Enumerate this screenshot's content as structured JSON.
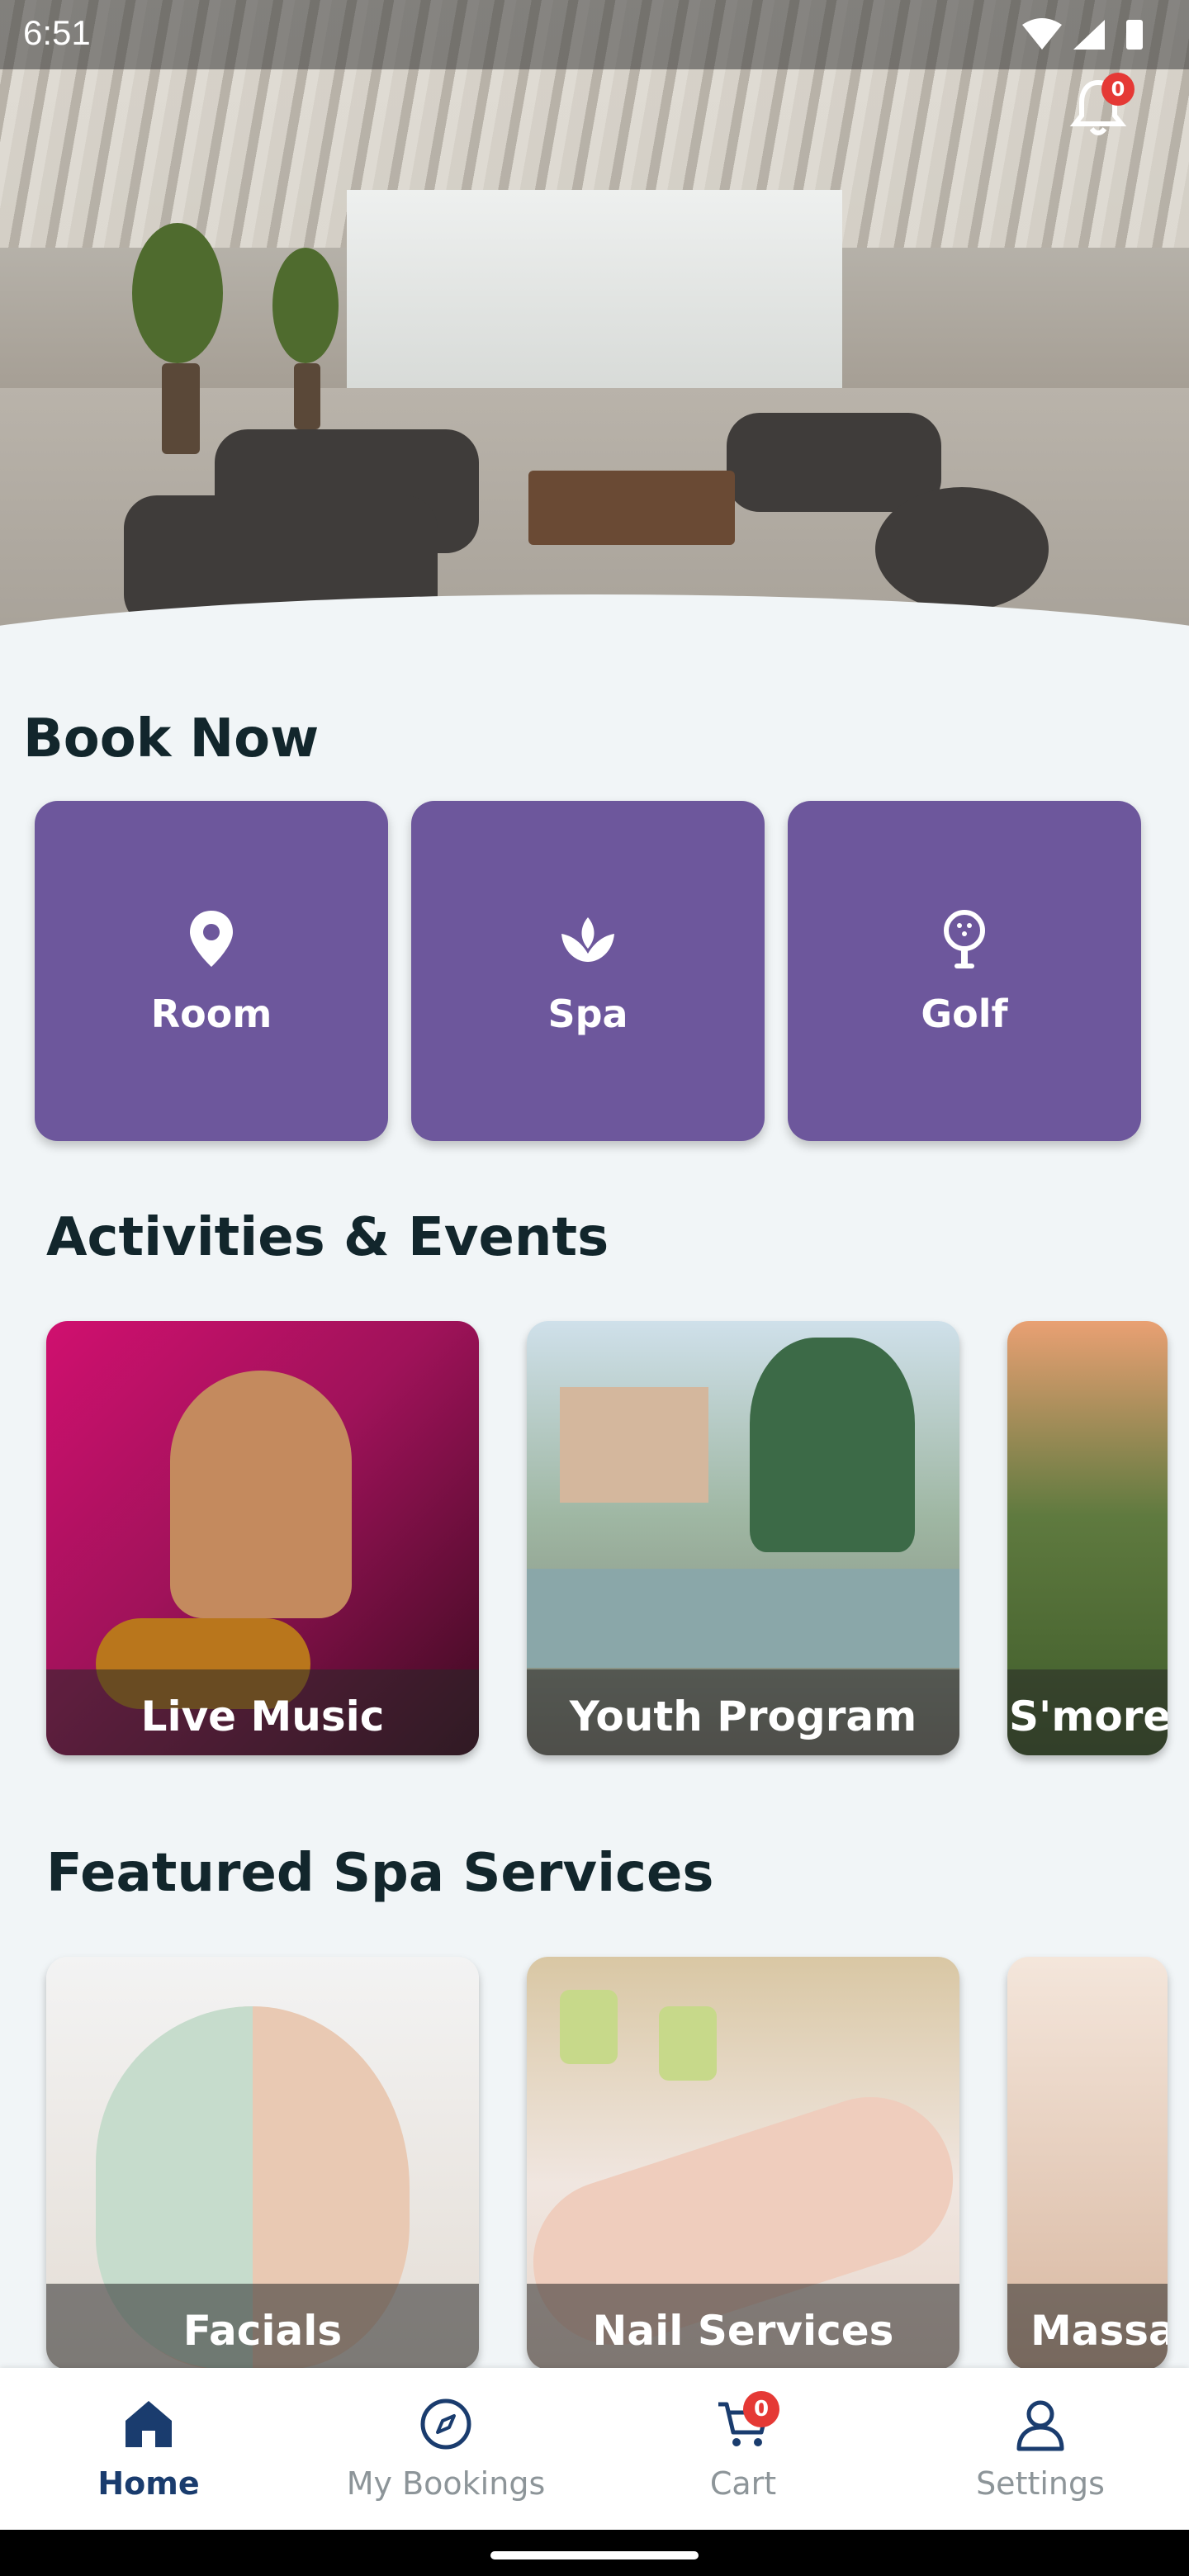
{
  "status_bar": {
    "time": "6:51"
  },
  "notifications": {
    "count": "0"
  },
  "book_now": {
    "title": "Book Now",
    "tiles": [
      {
        "label": "Room",
        "icon": "map-pin-icon"
      },
      {
        "label": "Spa",
        "icon": "lotus-icon"
      },
      {
        "label": "Golf",
        "icon": "golf-ball-icon"
      }
    ]
  },
  "activities": {
    "title": "Activities & Events",
    "cards": [
      {
        "label": "Live Music"
      },
      {
        "label": "Youth Program"
      },
      {
        "label": "S'mores"
      }
    ]
  },
  "spa_services": {
    "title": "Featured Spa Services",
    "cards": [
      {
        "label": "Facials"
      },
      {
        "label": "Nail Services"
      },
      {
        "label": "Massag"
      }
    ]
  },
  "bottom_nav": {
    "items": [
      {
        "label": "Home",
        "icon": "home-icon",
        "active": true
      },
      {
        "label": "My Bookings",
        "icon": "compass-icon",
        "active": false
      },
      {
        "label": "Cart",
        "icon": "cart-icon",
        "active": false,
        "badge": "0"
      },
      {
        "label": "Settings",
        "icon": "user-icon",
        "active": false
      }
    ]
  },
  "colors": {
    "tile_purple": "#6d579c",
    "nav_active": "#1a3c6e",
    "badge_red": "#e53935",
    "background": "#f1f5f7"
  }
}
